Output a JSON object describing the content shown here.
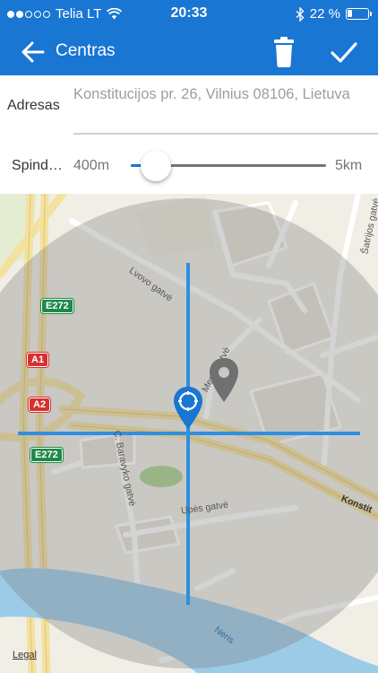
{
  "status_bar": {
    "carrier": "Telia LT",
    "time": "20:33",
    "battery_percent": "22 %",
    "battery_level": 0.22,
    "signal_bars_filled": 2,
    "signal_bars_total": 5
  },
  "toolbar": {
    "title": "Centras",
    "back_icon": "arrow-left-icon",
    "delete_icon": "trash-icon",
    "confirm_icon": "checkmark-icon",
    "background_color": "#1976d2"
  },
  "address": {
    "label": "Adresas",
    "value": "Konstitucijos pr. 26, Vilnius 08106, Lietuva"
  },
  "radius": {
    "label": "Spind…",
    "min_label": "400m",
    "max_label": "5km",
    "value_fraction": 0.13,
    "accent_color": "#1976d2"
  },
  "map": {
    "street_labels": {
      "lvovo": "Lvovo gatvė",
      "satrijos": "Šatrijos gatvė",
      "baravyko": "C. Baravyko gatvė",
      "upes": "Upės gatvė",
      "konstitucijos": "Konstit",
      "neris": "Neris",
      "menu": "Menu gatvė"
    },
    "road_shields": [
      {
        "label": "E272",
        "color": "green"
      },
      {
        "label": "A1",
        "color": "red"
      },
      {
        "label": "A2",
        "color": "red"
      },
      {
        "label": "E272",
        "color": "green"
      }
    ],
    "legal": "Legal",
    "center_pin_icon": "location-pin-icon",
    "secondary_pin_icon": "map-marker-icon"
  }
}
